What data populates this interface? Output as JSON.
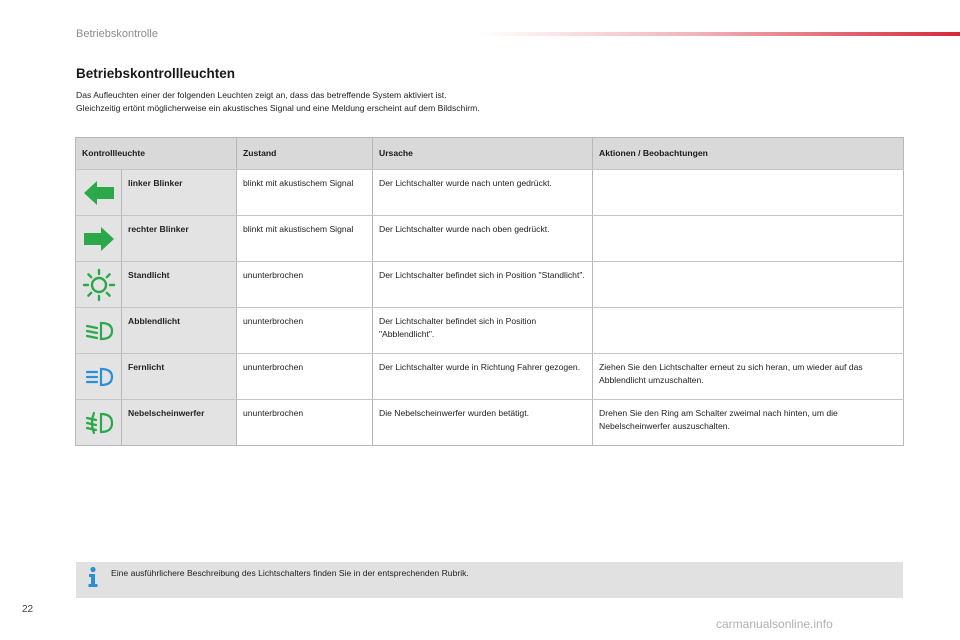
{
  "header": {
    "section": "Betriebskontrolle"
  },
  "title": "Betriebskontrollleuchten",
  "intro": [
    "Das Aufleuchten einer der folgenden Leuchten zeigt an, dass das betreffende System aktiviert ist.",
    "Gleichzeitig ertönt möglicherweise ein akustisches Signal und eine Meldung erscheint auf dem Bildschirm."
  ],
  "table": {
    "headers": [
      "Kontrollleuchte",
      "Zustand",
      "Ursache",
      "Aktionen / Beobachtungen"
    ],
    "rows": [
      {
        "icon": "left-turn-arrow-icon",
        "name": "linker Blinker",
        "state": "blinkt mit akustischem Signal",
        "cause": "Der Lichtschalter wurde nach unten gedrückt.",
        "action": ""
      },
      {
        "icon": "right-turn-arrow-icon",
        "name": "rechter Blinker",
        "state": "blinkt mit akustischem Signal",
        "cause": "Der Lichtschalter wurde nach oben gedrückt.",
        "action": ""
      },
      {
        "icon": "sidelight-icon",
        "name": "Standlicht",
        "state": "ununterbrochen",
        "cause": "Der Lichtschalter befindet sich in Position \"Standlicht\".",
        "action": ""
      },
      {
        "icon": "dipped-beam-icon",
        "name": "Abblendlicht",
        "state": "ununterbrochen",
        "cause": "Der Lichtschalter befindet sich in Position \"Abblendlicht\".",
        "action": ""
      },
      {
        "icon": "main-beam-icon",
        "name": "Fernlicht",
        "state": "ununterbrochen",
        "cause": "Der Lichtschalter wurde in Richtung Fahrer gezogen.",
        "action": "Ziehen Sie den Lichtschalter erneut zu sich heran, um wieder auf das Abblendlicht umzuschalten."
      },
      {
        "icon": "front-fog-lamp-icon",
        "name": "Nebelscheinwerfer",
        "state": "ununterbrochen",
        "cause": "Die Nebelscheinwerfer wurden betätigt.",
        "action": "Drehen Sie den Ring am Schalter zweimal nach hinten, um die Nebelscheinwerfer auszuschalten."
      }
    ]
  },
  "info": {
    "icon": "info-icon",
    "text": "Eine ausführlichere Beschreibung des Lichtschalters finden Sie in der entsprechenden Rubrik."
  },
  "page_number": "22",
  "watermark": "carmanualsonline.info",
  "colors": {
    "indicator_green": "#2aa84a",
    "info_blue": "#2a8fd6",
    "header_accent": "#d62839"
  }
}
